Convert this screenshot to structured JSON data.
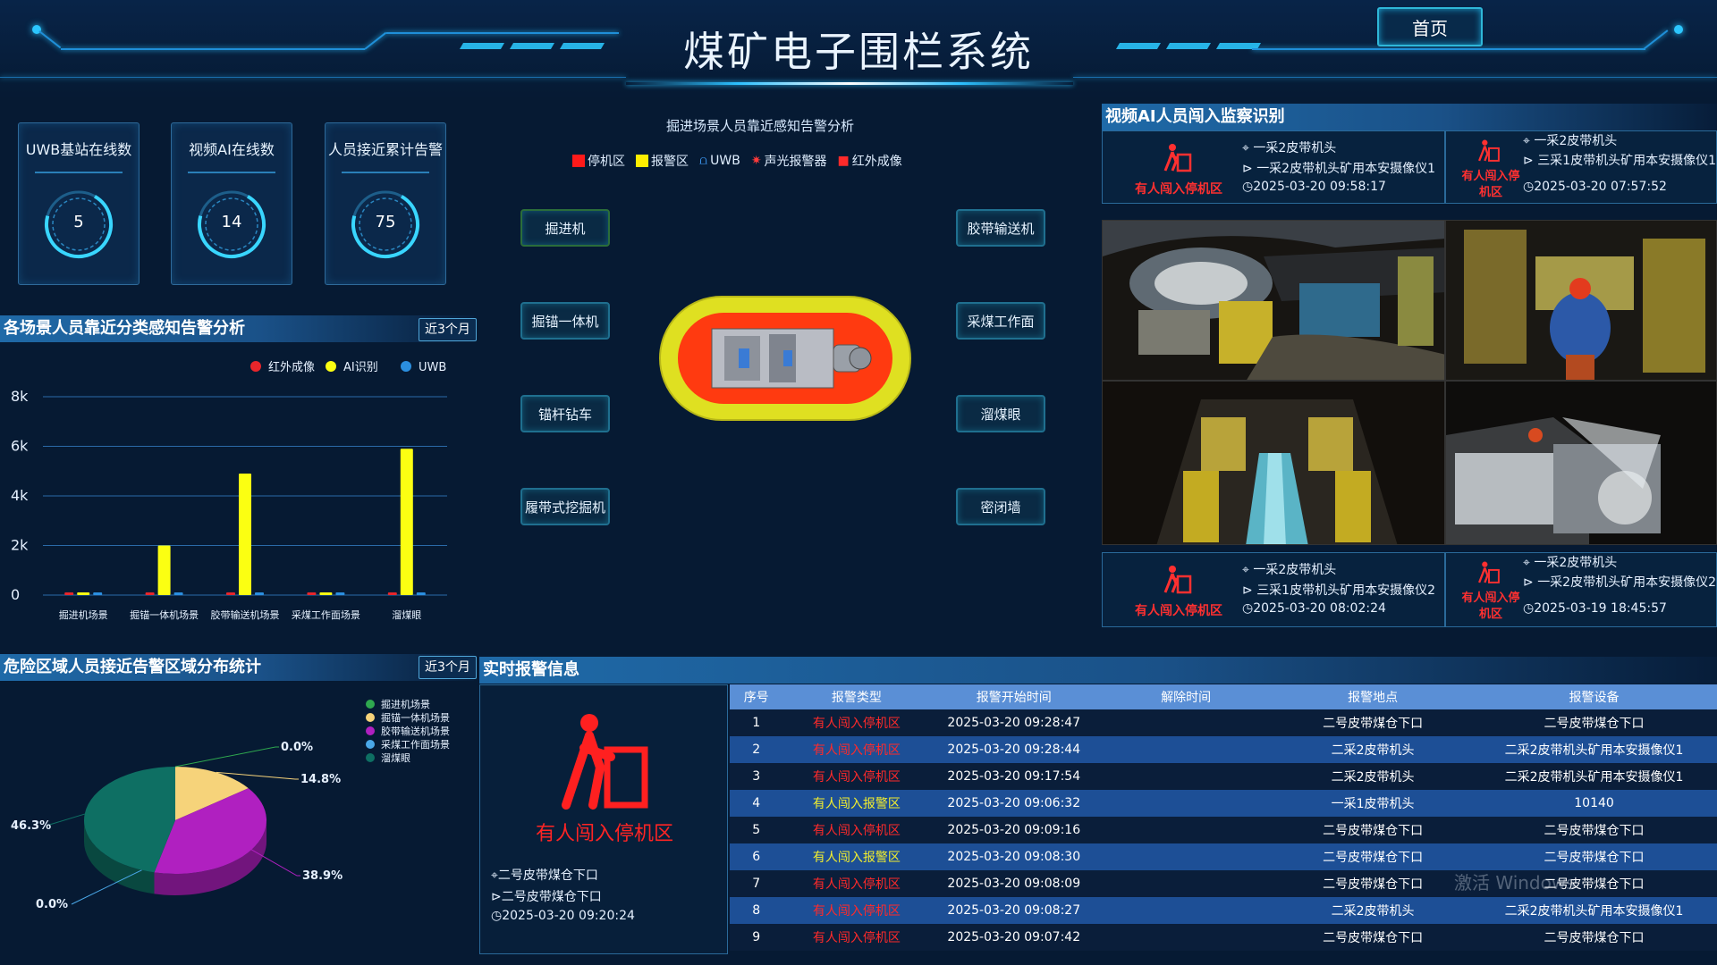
{
  "header": {
    "title": "煤矿电子围栏系统",
    "home_label": "首页"
  },
  "stats": [
    {
      "label": "UWB基站在线数",
      "value": "5"
    },
    {
      "label": "视频AI在线数",
      "value": "14"
    },
    {
      "label": "人员接近累计告警",
      "value": "75"
    }
  ],
  "scene_analysis": {
    "title": "各场景人员靠近分类感知告警分析",
    "range": "近3个月"
  },
  "chart_data": [
    {
      "type": "bar",
      "categories": [
        "掘进机场景",
        "掘锚一体机场景",
        "胶带输送机场景",
        "采煤工作面场景",
        "溜煤眼"
      ],
      "series": [
        {
          "name": "红外成像",
          "color": "#e8262b",
          "values": [
            0,
            0,
            0,
            0,
            0
          ]
        },
        {
          "name": "AI识别",
          "color": "#fbff12",
          "values": [
            0,
            2000,
            4900,
            0,
            5900
          ]
        },
        {
          "name": "UWB",
          "color": "#2b8fe0",
          "values": [
            0,
            0,
            0,
            0,
            0
          ]
        }
      ],
      "yticks": [
        "0",
        "2k",
        "4k",
        "6k",
        "8k"
      ],
      "ylim": [
        0,
        8000
      ],
      "legend": "top-right"
    },
    {
      "type": "pie",
      "categories": [
        "掘进机场景",
        "掘锚一体机场景",
        "胶带输送机场景",
        "采煤工作面场景",
        "溜煤眼"
      ],
      "values": [
        0.0,
        14.8,
        38.9,
        0.0,
        46.3
      ],
      "labels": [
        "0.0%",
        "14.8%",
        "38.9%",
        "0.0%",
        "46.3%"
      ],
      "colors": [
        "#2fa84f",
        "#f6d37a",
        "#b020c0",
        "#4aa8e8",
        "#0e6f63"
      ],
      "legend": "top-right"
    }
  ],
  "zone_analysis": {
    "title": "危险区域人员接近告警区域分布统计",
    "range": "近3个月"
  },
  "center": {
    "title": "掘进场景人员靠近感知告警分析",
    "legend": [
      {
        "label": "停机区",
        "color": "#ff1a1a"
      },
      {
        "label": "报警区",
        "color": "#ffee00"
      },
      {
        "label": "UWB",
        "color": "#3fa0ff"
      },
      {
        "label": "声光报警器",
        "color": "#ff3a3a"
      },
      {
        "label": "红外成像",
        "color": "#ff2a2a"
      }
    ],
    "left_buttons": [
      "掘进机",
      "掘锚一体机",
      "锚杆钻车",
      "履带式挖掘机"
    ],
    "right_buttons": [
      "胶带输送机",
      "采煤工作面",
      "溜煤眼",
      "密闭墙"
    ]
  },
  "video_ai": {
    "title": "视频AI人员闯入监察识别",
    "cards": [
      {
        "alert": "有人闯入停机区",
        "location": "一采2皮带机头",
        "device": "一采2皮带机头矿用本安摄像仪1",
        "time": "2025-03-20 09:58:17"
      },
      {
        "alert": "有人闯入停机区",
        "location": "一采2皮带机头",
        "device": "三采1皮带机头矿用本安摄像仪1",
        "time": "2025-03-20 07:57:52"
      },
      {
        "alert": "有人闯入停机区",
        "location": "一采2皮带机头",
        "device": "三采1皮带机头矿用本安摄像仪2",
        "time": "2025-03-20 08:02:24"
      },
      {
        "alert": "有人闯入停机区",
        "location": "一采2皮带机头",
        "device": "一采2皮带机头矿用本安摄像仪2",
        "time": "2025-03-19 18:45:57"
      }
    ]
  },
  "realtime": {
    "title": "实时报警信息",
    "current": {
      "alert": "有人闯入停机区",
      "location": "二号皮带煤仓下口",
      "device": "二号皮带煤仓下口",
      "time": "2025-03-20 09:20:24"
    },
    "columns": [
      "序号",
      "报警类型",
      "报警开始时间",
      "解除时间",
      "报警地点",
      "报警设备"
    ],
    "rows": [
      {
        "no": "1",
        "type": "有人闯入停机区",
        "level": "red",
        "start": "2025-03-20 09:28:47",
        "end": "",
        "place": "二号皮带煤仓下口",
        "device": "二号皮带煤仓下口"
      },
      {
        "no": "2",
        "type": "有人闯入停机区",
        "level": "red",
        "start": "2025-03-20 09:28:44",
        "end": "",
        "place": "二采2皮带机头",
        "device": "二采2皮带机头矿用本安摄像仪1"
      },
      {
        "no": "3",
        "type": "有人闯入停机区",
        "level": "red",
        "start": "2025-03-20 09:17:54",
        "end": "",
        "place": "二采2皮带机头",
        "device": "二采2皮带机头矿用本安摄像仪1"
      },
      {
        "no": "4",
        "type": "有人闯入报警区",
        "level": "yellow",
        "start": "2025-03-20 09:06:32",
        "end": "",
        "place": "一采1皮带机头",
        "device": "10140"
      },
      {
        "no": "5",
        "type": "有人闯入停机区",
        "level": "red",
        "start": "2025-03-20 09:09:16",
        "end": "",
        "place": "二号皮带煤仓下口",
        "device": "二号皮带煤仓下口"
      },
      {
        "no": "6",
        "type": "有人闯入报警区",
        "level": "yellow",
        "start": "2025-03-20 09:08:30",
        "end": "",
        "place": "二号皮带煤仓下口",
        "device": "二号皮带煤仓下口"
      },
      {
        "no": "7",
        "type": "有人闯入停机区",
        "level": "red",
        "start": "2025-03-20 09:08:09",
        "end": "",
        "place": "二号皮带煤仓下口",
        "device": "二号皮带煤仓下口"
      },
      {
        "no": "8",
        "type": "有人闯入停机区",
        "level": "red",
        "start": "2025-03-20 09:08:27",
        "end": "",
        "place": "二采2皮带机头",
        "device": "二采2皮带机头矿用本安摄像仪1"
      },
      {
        "no": "9",
        "type": "有人闯入停机区",
        "level": "red",
        "start": "2025-03-20 09:07:42",
        "end": "",
        "place": "二号皮带煤仓下口",
        "device": "二号皮带煤仓下口"
      }
    ]
  },
  "watermark": "激活 Windows"
}
